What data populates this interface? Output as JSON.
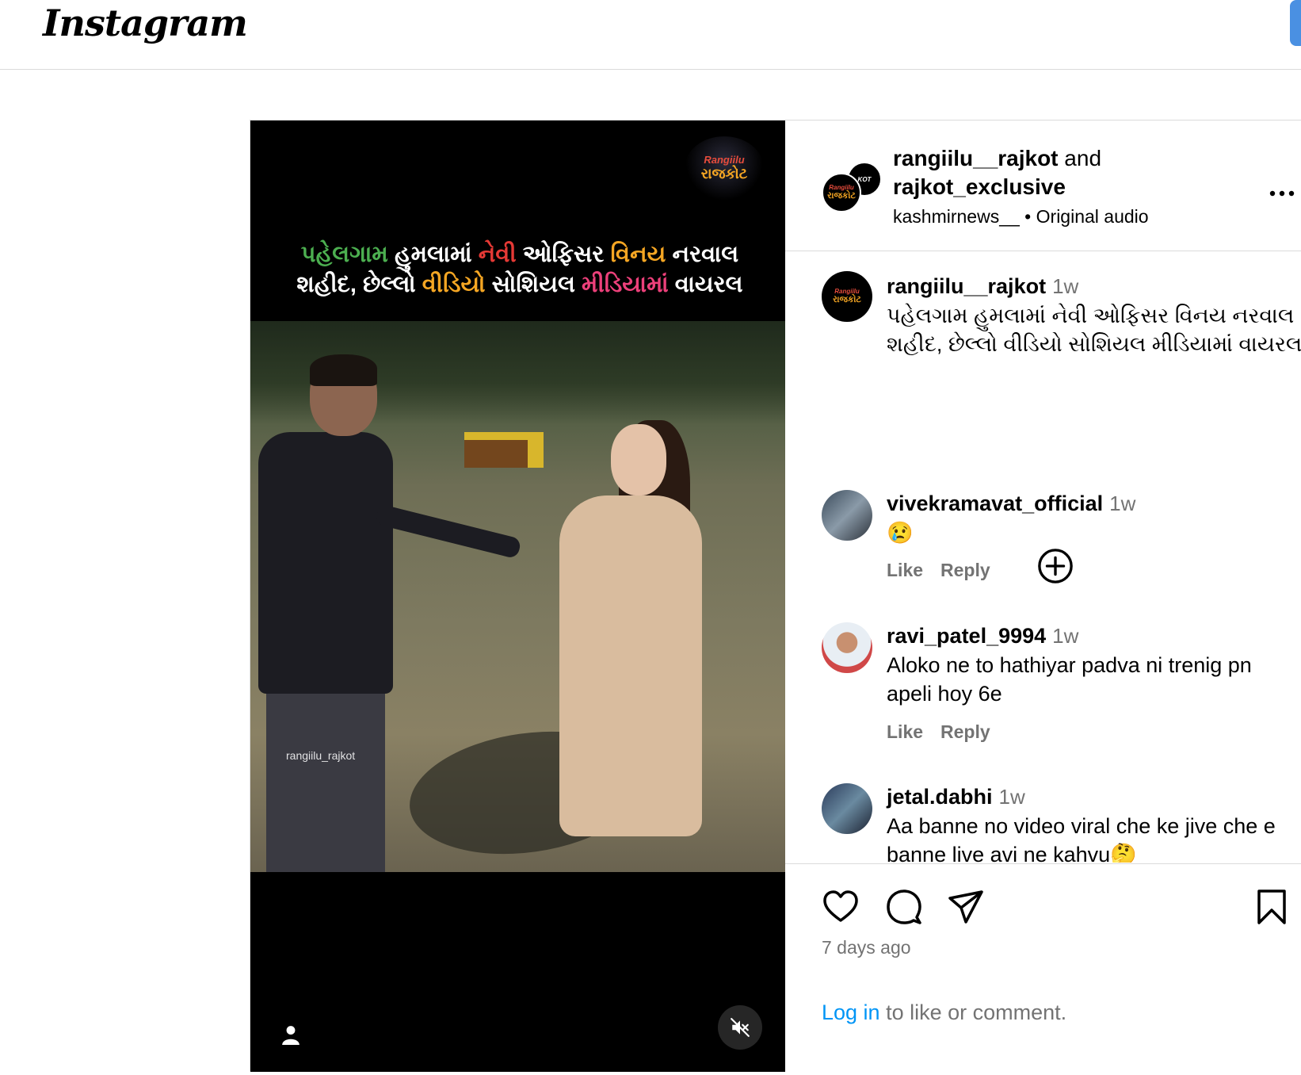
{
  "app": {
    "logo": "Instagram"
  },
  "media": {
    "badge_top": "Rangiilu",
    "badge_bottom": "રાજકોટ",
    "headline_parts": [
      "પહેલગામ",
      " હુમલામાં ",
      "નેવી",
      " ઓફિસર ",
      "વિનય",
      " નરવાલ",
      "શહીદ, છેલ્લો ",
      "વીડિયો",
      " સોશિયલ ",
      "મીડિયામાં",
      " વાયરલ"
    ],
    "watermark": "rangiilu_rajkot"
  },
  "header": {
    "user1": "rangiilu__rajkot",
    "and": " and",
    "user2": "rajkot_exclusive",
    "audio_user": "kashmirnews__",
    "separator": " • ",
    "audio": "Original audio",
    "avatar_back_text": "KOT",
    "avatar_front_top": "Rangiilu",
    "avatar_front_bottom": "રાજકોટ"
  },
  "caption": {
    "user": "rangiilu__rajkot",
    "time": "1w",
    "text": "પહેલગામ હુમલામાં નેવી ઓફિસર વિનય નરવાલ શહીદ, છેલ્લો વીડિયો સોશિયલ મીડિયામાં વાયરલ"
  },
  "comments": [
    {
      "user": "vivekramavat_official",
      "time": "1w",
      "text": "😢",
      "like": "Like",
      "reply": "Reply"
    },
    {
      "user": "ravi_patel_9994",
      "time": "1w",
      "text": "Aloko ne to hathiyar padva ni trenig pn apeli hoy 6e",
      "like": "Like",
      "reply": "Reply"
    },
    {
      "user": "jetal.dabhi",
      "time": "1w",
      "text": "Aa banne no video viral che ke jive che e banne live avi ne kahvu🤔"
    }
  ],
  "footer": {
    "time_ago": "7 days ago",
    "login_link": "Log in",
    "login_rest": " to like or comment."
  }
}
